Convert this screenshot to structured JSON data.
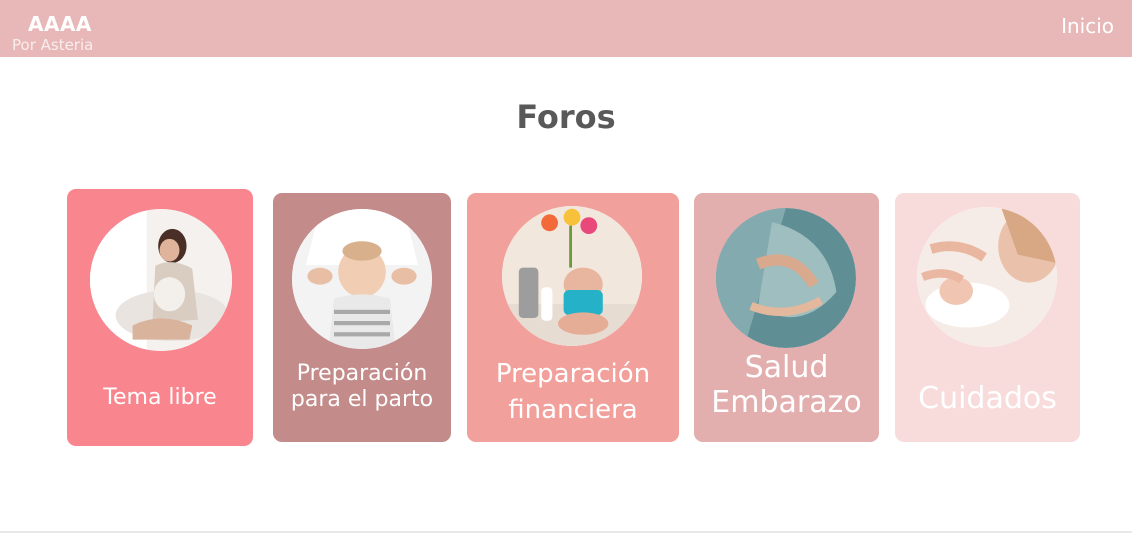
{
  "header": {
    "title": "AAAA",
    "subtitle": "Por Asteria",
    "nav_home": "Inicio"
  },
  "page": {
    "title": "Foros"
  },
  "colors": {
    "header_bg": "#e8b8b8",
    "card_tema_libre": "#f9858e",
    "card_parto": "#c48b8b",
    "card_financiera": "#f2a09b",
    "card_salud": "#e3aeae",
    "card_cuidados": "#f8dcdc"
  },
  "forums": [
    {
      "line1": "Tema libre",
      "line2": "",
      "image": "pregnant-woman-photo"
    },
    {
      "line1": "Preparación",
      "line2": "para el parto",
      "image": "baby-checkup-photo"
    },
    {
      "line1": "Preparación",
      "line2": "financiera",
      "image": "baby-toys-photo"
    },
    {
      "line1": "Salud",
      "line2": "Embarazo",
      "image": "pregnancy-belly-photo"
    },
    {
      "line1": "Cuidados",
      "line2": "",
      "image": "mother-baby-photo"
    }
  ]
}
